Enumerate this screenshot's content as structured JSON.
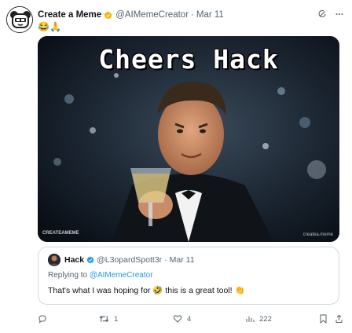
{
  "post": {
    "author_name": "Create a Meme",
    "handle": "@AIMemeCreator",
    "separator": "·",
    "date": "Mar 11",
    "text": "😂🙏",
    "media": {
      "caption": "Cheers Hack",
      "watermark_left": "CREATEAMEME",
      "watermark_right": "createa.meme"
    }
  },
  "quote": {
    "author_name": "Hack",
    "handle": "@L3opardSpott3r",
    "separator": "·",
    "date": "Mar 11",
    "replying_prefix": "Replying to",
    "replying_to": "@AIMemeCreator",
    "text_before": "That's what I was hoping for",
    "emoji_mid": "🤣",
    "text_after": "this is a great tool!",
    "emoji_end": "👏"
  },
  "actions": {
    "reposts": "1",
    "likes": "4",
    "views": "222"
  },
  "colors": {
    "verified_badge": "#f4b400",
    "quote_verified_badge": "#1d9bf0",
    "link": "#1d9bf0",
    "muted_text": "#536471"
  }
}
